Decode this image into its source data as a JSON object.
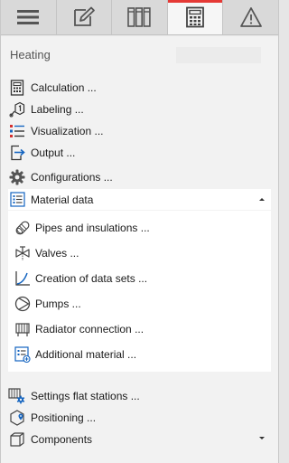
{
  "tabs": [
    {
      "icon": "hamburger-menu-icon",
      "active": false
    },
    {
      "icon": "edit-pencil-icon",
      "active": false
    },
    {
      "icon": "binders-icon",
      "active": false
    },
    {
      "icon": "calculator-icon",
      "active": true
    },
    {
      "icon": "warning-triangle-icon",
      "active": false
    }
  ],
  "accent_color": "#e53935",
  "section": {
    "title": "Heating"
  },
  "menu": [
    {
      "label": "Calculation ...",
      "icon": "calculator-icon"
    },
    {
      "label": "Labeling ...",
      "icon": "label-tag-icon"
    },
    {
      "label": "Visualization ...",
      "icon": "visualization-list-icon"
    },
    {
      "label": "Output ...",
      "icon": "output-arrow-icon"
    },
    {
      "label": "Configurations ...",
      "icon": "gear-icon"
    },
    {
      "label": "Material data",
      "icon": "material-list-icon",
      "expanded": true,
      "caret": "up"
    }
  ],
  "material_data": [
    {
      "label": "Pipes and insulations ...",
      "icon": "pipe-icon"
    },
    {
      "label": "Valves ...",
      "icon": "valve-icon"
    },
    {
      "label": "Creation of data sets ...",
      "icon": "curve-chart-icon"
    },
    {
      "label": "Pumps ...",
      "icon": "pump-icon"
    },
    {
      "label": "Radiator connection ...",
      "icon": "radiator-icon"
    },
    {
      "label": "Additional material ...",
      "icon": "additional-material-icon"
    }
  ],
  "bottom_menu": [
    {
      "label": "Settings flat stations ...",
      "icon": "flat-station-settings-icon"
    },
    {
      "label": "Positioning ...",
      "icon": "positioning-icon"
    },
    {
      "label": "Components",
      "icon": "components-cube-icon",
      "caret": "down"
    }
  ]
}
